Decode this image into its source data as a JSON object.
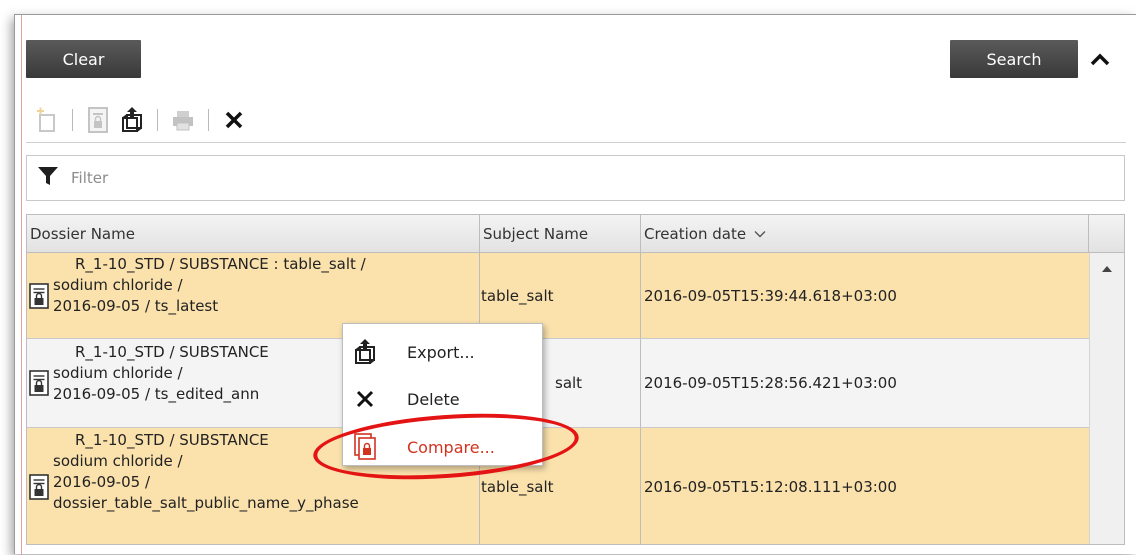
{
  "toolbar_top": {
    "clear_label": "Clear",
    "search_label": "Search"
  },
  "filter": {
    "placeholder": "Filter"
  },
  "grid": {
    "headers": {
      "name": "Dossier Name",
      "subject": "Subject Name",
      "date": "Creation date"
    },
    "rows": [
      {
        "name_lines": [
          "R_1-10_STD / SUBSTANCE : table_salt /",
          "sodium chloride /",
          "2016-09-05 / ts_latest"
        ],
        "subject": "table_salt",
        "date": "2016-09-05T15:39:44.618+03:00"
      },
      {
        "name_lines": [
          "R_1-10_STD / SUBSTANCE",
          "sodium chloride /",
          "2016-09-05 / ts_edited_ann"
        ],
        "subject": "salt",
        "date": "2016-09-05T15:28:56.421+03:00"
      },
      {
        "name_lines": [
          "R_1-10_STD / SUBSTANCE",
          "sodium chloride /",
          "2016-09-05 /",
          "dossier_table_salt_public_name_y_phase"
        ],
        "subject": "table_salt",
        "date": "2016-09-05T15:12:08.111+03:00"
      }
    ]
  },
  "context_menu": {
    "export_label": "Export...",
    "delete_label": "Delete",
    "compare_label": "Compare..."
  },
  "colors": {
    "selected_row": "#fbe2ad",
    "highlight": "#e41414",
    "compare_text": "#d2331f"
  }
}
